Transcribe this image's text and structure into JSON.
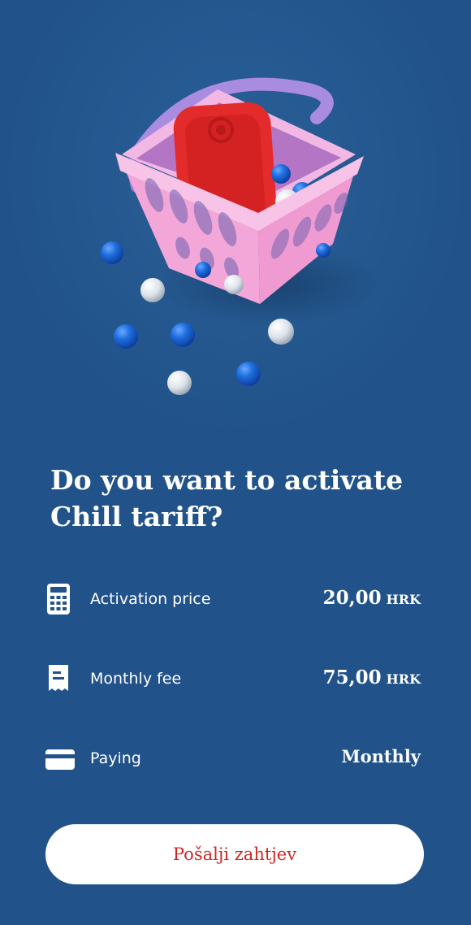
{
  "title": "Do you want to activate Chill tariff?",
  "rows": [
    {
      "icon": "calculator-icon",
      "label": "Activation price",
      "amount": "20,00",
      "currency": "HRK"
    },
    {
      "icon": "receipt-icon",
      "label": "Monthly fee",
      "amount": "75,00",
      "currency": "HRK"
    },
    {
      "icon": "credit-card-icon",
      "label": "Paying",
      "value": "Monthly"
    }
  ],
  "submit_label": "Pošalji zahtjev",
  "colors": {
    "background": "#21538a",
    "text": "#ffffff",
    "button_bg": "#ffffff",
    "button_text": "#d32424"
  }
}
